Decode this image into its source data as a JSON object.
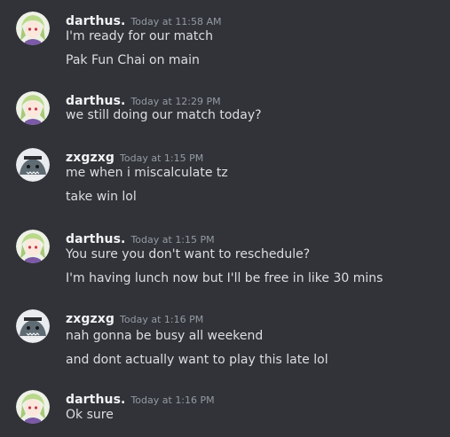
{
  "messages": [
    {
      "author": "darthus.",
      "timestamp": "Today at 11:58 AM",
      "avatar": "anime-avatar-icon",
      "lines": [
        "I'm ready for our match",
        "Pak Fun Chai on main"
      ]
    },
    {
      "author": "darthus.",
      "timestamp": "Today at 12:29 PM",
      "avatar": "anime-avatar-icon",
      "lines": [
        "we still doing our match today?"
      ]
    },
    {
      "author": "zxgzxg",
      "timestamp": "Today at 1:15 PM",
      "avatar": "shark-avatar-icon",
      "lines": [
        "me when i miscalculate tz",
        "take win lol"
      ]
    },
    {
      "author": "darthus.",
      "timestamp": "Today at 1:15 PM",
      "avatar": "anime-avatar-icon",
      "lines": [
        "You sure you don't want to reschedule?",
        "I'm having lunch now but I'll be free in like 30 mins"
      ]
    },
    {
      "author": "zxgzxg",
      "timestamp": "Today at 1:16 PM",
      "avatar": "shark-avatar-icon",
      "lines": [
        "nah gonna be busy all weekend",
        "and dont actually want to play this late lol"
      ]
    },
    {
      "author": "darthus.",
      "timestamp": "Today at 1:16 PM",
      "avatar": "anime-avatar-icon",
      "lines": [
        "Ok sure"
      ]
    }
  ],
  "colors": {
    "background": "#313338",
    "username": "#f2f3f5",
    "timestamp": "#949ba4",
    "text": "#dbdee1"
  }
}
